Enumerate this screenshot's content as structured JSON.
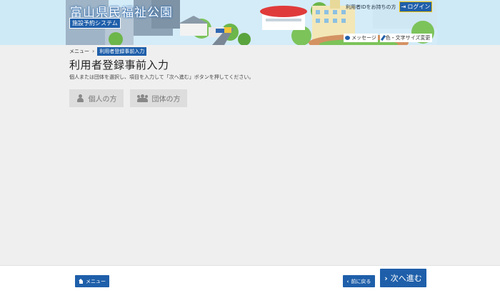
{
  "header": {
    "site_title": "富山県民福祉公園",
    "site_subtitle": "施設予約システム",
    "login_prompt": "利用者IDをお持ちの方",
    "login_label": "ログイン",
    "message_label": "メッセージ",
    "color_size_label": "色・文字サイズ変更"
  },
  "breadcrumb": {
    "menu": "メニュー",
    "separator": "›",
    "current": "利用者登録事前入力"
  },
  "main": {
    "title": "利用者登録事前入力",
    "instruction": "個人または団体を選択し、項目を入力して「次へ進む」ボタンを押してください。",
    "individual_label": "個人の方",
    "group_label": "団体の方"
  },
  "footer": {
    "menu_label": "メニュー",
    "back_label": "前に戻る",
    "next_label": "次へ進む",
    "back_chevron": "‹",
    "next_chevron": "›"
  },
  "icons": {
    "login": "login-icon",
    "message": "speech-bubble-icon",
    "color": "brush-icon",
    "individual": "person-icon",
    "group": "group-icon",
    "menu": "home-icon"
  },
  "colors": {
    "accent": "#1f5faa",
    "page_bg": "#efefef",
    "disabled_button": "#dddddd"
  }
}
